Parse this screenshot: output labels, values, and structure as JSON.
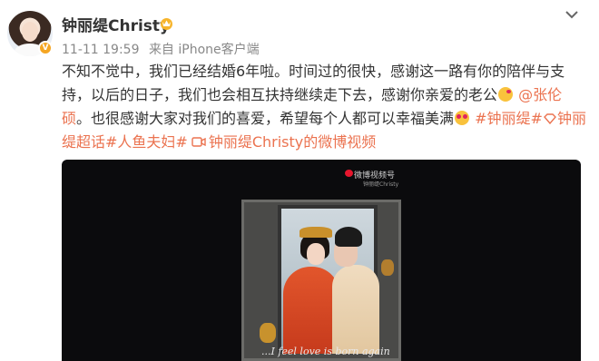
{
  "post": {
    "username": "钟丽缇Christy",
    "timestamp": "11-11 19:59",
    "source": "来自 iPhone客户端",
    "icons": {
      "verified": "verified-badge-icon",
      "vip": "vip-crown-icon",
      "menu": "chevron-down-icon"
    },
    "content": {
      "line1": "不知不觉中，我们已经结婚6年啦。时间过的很快，感谢这一路有你的陪伴与支",
      "line2_text": "持，以后的日子，我们也会相互扶持继续走下去，感谢你亲爱的老公",
      "mention_1": "@张伦",
      "mention_2": "硕",
      "line3_text": "。也很感谢大家对我们的喜爱，希望每个人都可以幸福美满",
      "hashtag_1": "#钟丽缇#",
      "hashtag_2_part1": "钟丽",
      "hashtag_2_part2": "缇超话",
      "hashtag_3": "#人鱼夫妇#",
      "video_link": "钟丽缇Christy的微博视频"
    },
    "video": {
      "watermark": "微博视频号",
      "watermark_sub": "钟丽缇Christy",
      "subtitle": "...I feel love is born again"
    },
    "colors": {
      "link": "#eb7350",
      "text": "#333333",
      "meta": "#888888",
      "video_bg": "#0b0b0d"
    }
  }
}
